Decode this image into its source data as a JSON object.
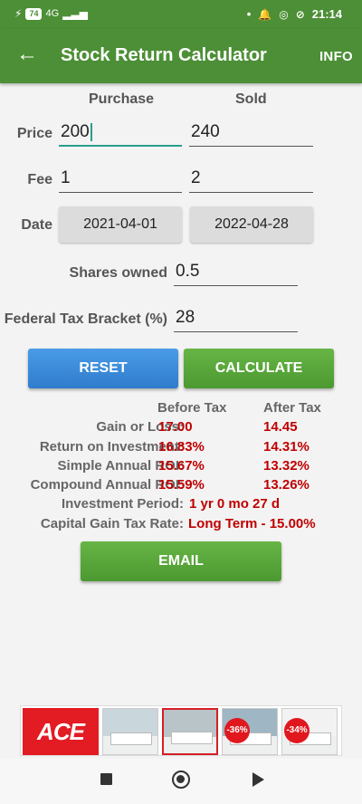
{
  "status_bar": {
    "battery": "74",
    "network": "4G",
    "time": "21:14",
    "dot": "•"
  },
  "app_bar": {
    "back_icon": "arrow-back-icon",
    "title": "Stock Return Calculator",
    "info_label": "INFO"
  },
  "columns": {
    "purchase": "Purchase",
    "sold": "Sold"
  },
  "price": {
    "label": "Price",
    "purchase": "200",
    "sold": "240"
  },
  "fee": {
    "label": "Fee",
    "purchase": "1",
    "sold": "2"
  },
  "date": {
    "label": "Date",
    "purchase": "2021-04-01",
    "sold": "2022-04-28"
  },
  "shares": {
    "label": "Shares owned",
    "value": "0.5"
  },
  "tax_bracket": {
    "label": "Federal Tax Bracket (%)",
    "value": "28"
  },
  "buttons": {
    "reset": "RESET",
    "calculate": "CALCULATE",
    "email": "EMAIL"
  },
  "results": {
    "before_tax_header": "Before Tax",
    "after_tax_header": "After Tax",
    "gain": {
      "label": "Gain or Loss:",
      "before": "17.00",
      "after": "14.45"
    },
    "roi": {
      "label": "Return on Investment:",
      "before": "16.83%",
      "after": "14.31%"
    },
    "simple_roi": {
      "label": "Simple Annual ROI:",
      "before": "15.67%",
      "after": "13.32%"
    },
    "compound_roi": {
      "label": "Compound Annual ROI:",
      "before": "15.59%",
      "after": "13.26%"
    },
    "period": {
      "label": "Investment Period:",
      "value": "1 yr  0 mo  27 d"
    },
    "cgt_rate": {
      "label": "Capital Gain Tax Rate:",
      "value": "Long Term - 15.00%"
    }
  },
  "ad": {
    "brand": "ACE",
    "discount_1": "-36%",
    "discount_2": "-34%"
  },
  "colors": {
    "bar_green": "#4c8f36",
    "value_red": "#c00000",
    "reset_blue": "#3a8ad8",
    "calc_green": "#58a83b"
  }
}
